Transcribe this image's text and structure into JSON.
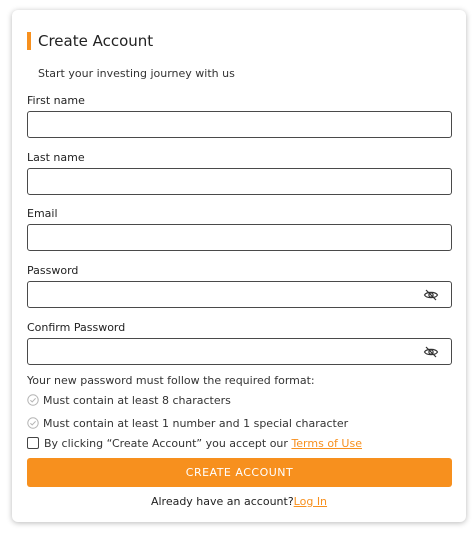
{
  "form": {
    "title": "Create Account",
    "subtitle": "Start your investing journey with us",
    "first_name": {
      "label": "First name",
      "value": "",
      "placeholder": ""
    },
    "last_name": {
      "label": "Last name",
      "value": "",
      "placeholder": ""
    },
    "email": {
      "label": "Email",
      "value": "",
      "placeholder": ""
    },
    "password": {
      "label": "Password",
      "value": "",
      "placeholder": "",
      "toggle_icon": "eye-slash-icon"
    },
    "confirm_password": {
      "label": "Confirm Password",
      "value": "",
      "placeholder": "",
      "toggle_icon": "eye-slash-icon"
    },
    "format_note": "Your new password must follow the required format:",
    "rules": [
      {
        "text": "Must contain at least 8 characters",
        "met": false,
        "icon": "check-circle-icon"
      },
      {
        "text": "Must contain at least 1 number and 1 special character",
        "met": false,
        "icon": "check-circle-icon"
      }
    ],
    "terms": {
      "checked": false,
      "text": "By clicking “Create Account” you accept our ",
      "link_label": "Terms of Use"
    },
    "submit_label": "CREATE ACCOUNT",
    "login": {
      "prompt": "Already have an account?",
      "link_label": "Log In"
    }
  },
  "colors": {
    "accent": "#f7901e",
    "border": "#4a4a4a",
    "rule_icon": "#b5b5b5"
  }
}
